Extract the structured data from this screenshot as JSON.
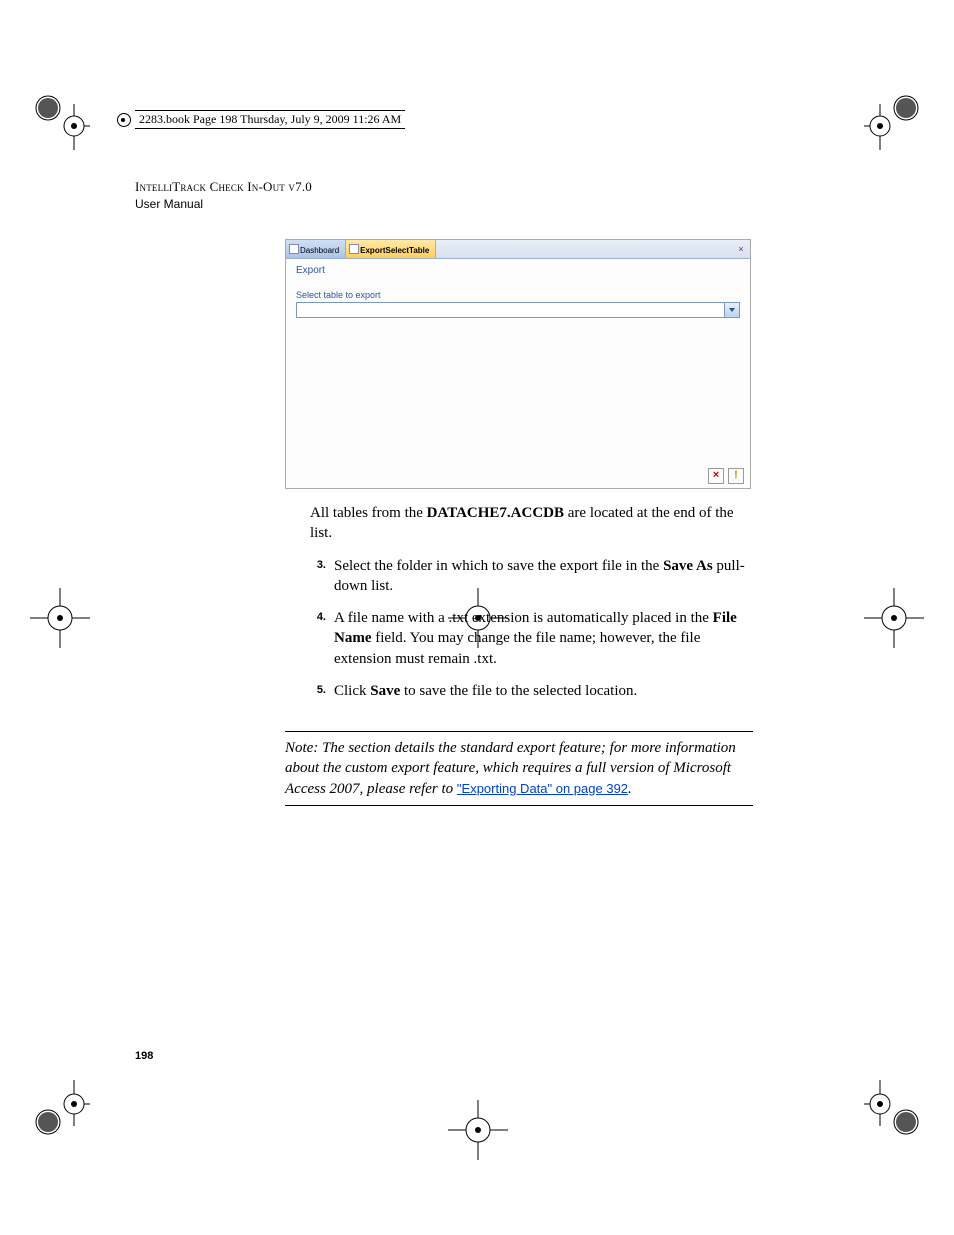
{
  "book_header": "2283.book  Page 198  Thursday, July 9, 2009  11:26 AM",
  "doc_title": "IntelliTrack Check In-Out v7.0",
  "doc_subtitle": "User Manual",
  "screenshot": {
    "tab_inactive": "Dashboard",
    "tab_active": "ExportSelectTable",
    "close_glyph": "×",
    "section_label": "Export",
    "field_label": "Select table to export",
    "icon_x": "×",
    "icon_i": "!"
  },
  "para_after_image_pre": "All tables from the ",
  "para_after_image_bold": "DATACHE7.ACCDB",
  "para_after_image_post": " are located at the end of the list.",
  "steps": {
    "s3": {
      "num": "3.",
      "t1": "Select the folder in which to save the export file in the ",
      "b1": "Save As",
      "t2": " pull-down list."
    },
    "s4": {
      "num": "4.",
      "t1": "A file name with a .txt extension is automatically placed in the ",
      "b1": "File Name",
      "t2": " field. You may change the file name; however, the file extension must remain .txt."
    },
    "s5": {
      "num": "5.",
      "t1": "Click ",
      "b1": "Save",
      "t2": " to save the file to the selected location."
    }
  },
  "note": {
    "prefix": "Note:   The section details the standard export feature; for more information about the custom export feature, which requires a full version of Microsoft Access 2007, please refer to ",
    "link": "\"Exporting Data\" on page 392",
    "suffix": "."
  },
  "page_number": "198"
}
